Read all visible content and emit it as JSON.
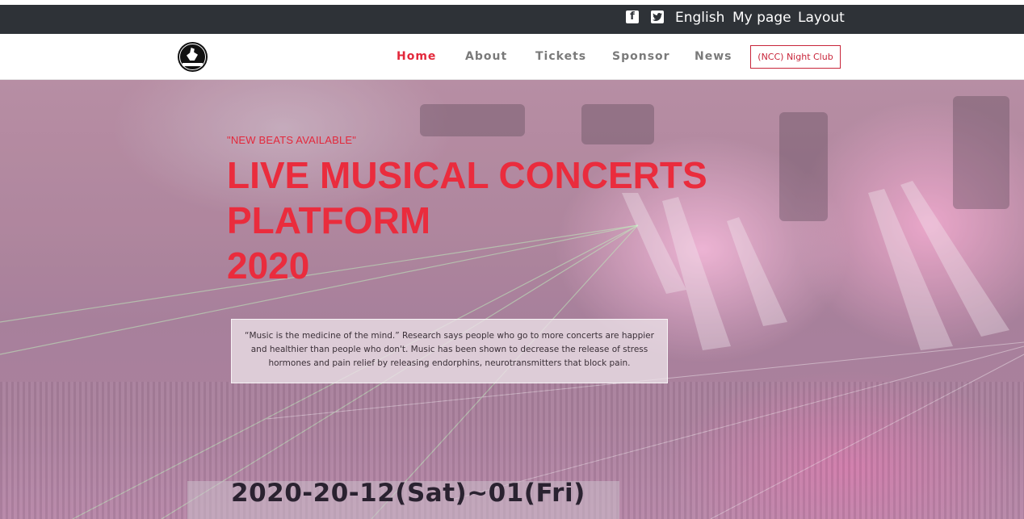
{
  "topbar": {
    "icons": [
      "facebook-square-icon",
      "twitter-square-icon"
    ],
    "links": [
      "English",
      "My page",
      "Layout"
    ]
  },
  "nav": {
    "logo": "concert-logo",
    "items": [
      "Home",
      "About",
      "Tickets",
      "Sponsor",
      "News"
    ],
    "active": "Home",
    "club_button": "(NCC) Night Club"
  },
  "hero": {
    "tagline": "\"NEW BEATS AVAILABLE\"",
    "title_lines": [
      "LIVE MUSICAL CONCERTS",
      "PLATFORM",
      "2020"
    ],
    "quote": "“Music is the medicine of the mind.” Research says people who go to more concerts are happier and healthier than people who don't. Music has been shown to decrease the release of stress hormones and pain relief by releasing endorphins, neurotransmitters that block pain.",
    "date": "2020-20-12(Sat)~01(Fri)"
  },
  "colors": {
    "accent": "#e3283b",
    "topbar": "#2e3237",
    "nav_text": "#7a7a7a"
  }
}
